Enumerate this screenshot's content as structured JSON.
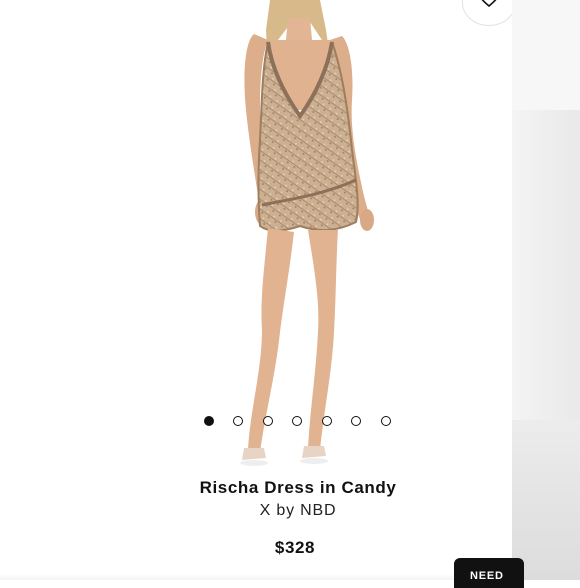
{
  "product": {
    "name": "Rischa Dress in Candy",
    "brand": "X by NBD",
    "price": "$328"
  },
  "carousel": {
    "total_images": 7,
    "active_index": 0
  },
  "help_chat": {
    "label": "NEED"
  },
  "icons": {
    "wishlist": "heart-outline-icon"
  },
  "colors": {
    "text": "#111111",
    "accent": "#111111",
    "dress": "#c7a888"
  }
}
